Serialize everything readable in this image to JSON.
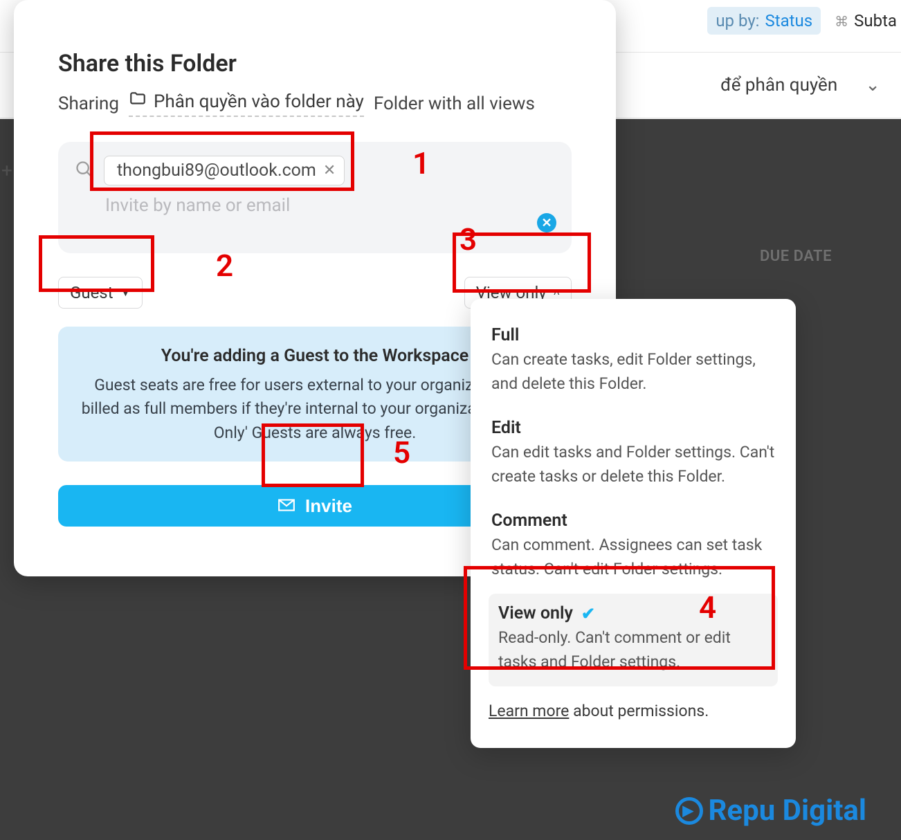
{
  "bg": {
    "groupby_label": "up by:",
    "groupby_value": "Status",
    "subtasks": "Subta",
    "perm_dd": "để phân quyền",
    "due_date": "DUE DATE"
  },
  "modal": {
    "title": "Share this Folder",
    "sharing_label": "Sharing",
    "folder_name": "Phân quyền vào folder này",
    "folder_suffix": "Folder with all views",
    "invite": {
      "chip_email": "thongbui89@outlook.com",
      "placeholder": "Invite by name or email"
    },
    "role_select": "Guest",
    "perm_select": "View only",
    "info": {
      "title": "You're adding a Guest to the Workspace",
      "body": "Guest seats are free for users external to your organization but billed as full members if they're internal to your organization. 'View Only' Guests are always free."
    },
    "invite_button": "Invite"
  },
  "perm_dropdown": {
    "options": [
      {
        "name": "Full",
        "desc": "Can create tasks, edit Folder settings, and delete this Folder."
      },
      {
        "name": "Edit",
        "desc": "Can edit tasks and Folder settings. Can't create tasks or delete this Folder."
      },
      {
        "name": "Comment",
        "desc": "Can comment. Assignees can set task status. Can't edit Folder settings."
      },
      {
        "name": "View only",
        "desc": "Read-only. Can't comment or edit tasks and Folder settings."
      }
    ],
    "selected_index": 3,
    "learn_more": "Learn more",
    "learn_more_suffix": " about permissions."
  },
  "annotations": {
    "1": "1",
    "2": "2",
    "3": "3",
    "4": "4",
    "5": "5"
  },
  "watermark": "Repu Digital"
}
